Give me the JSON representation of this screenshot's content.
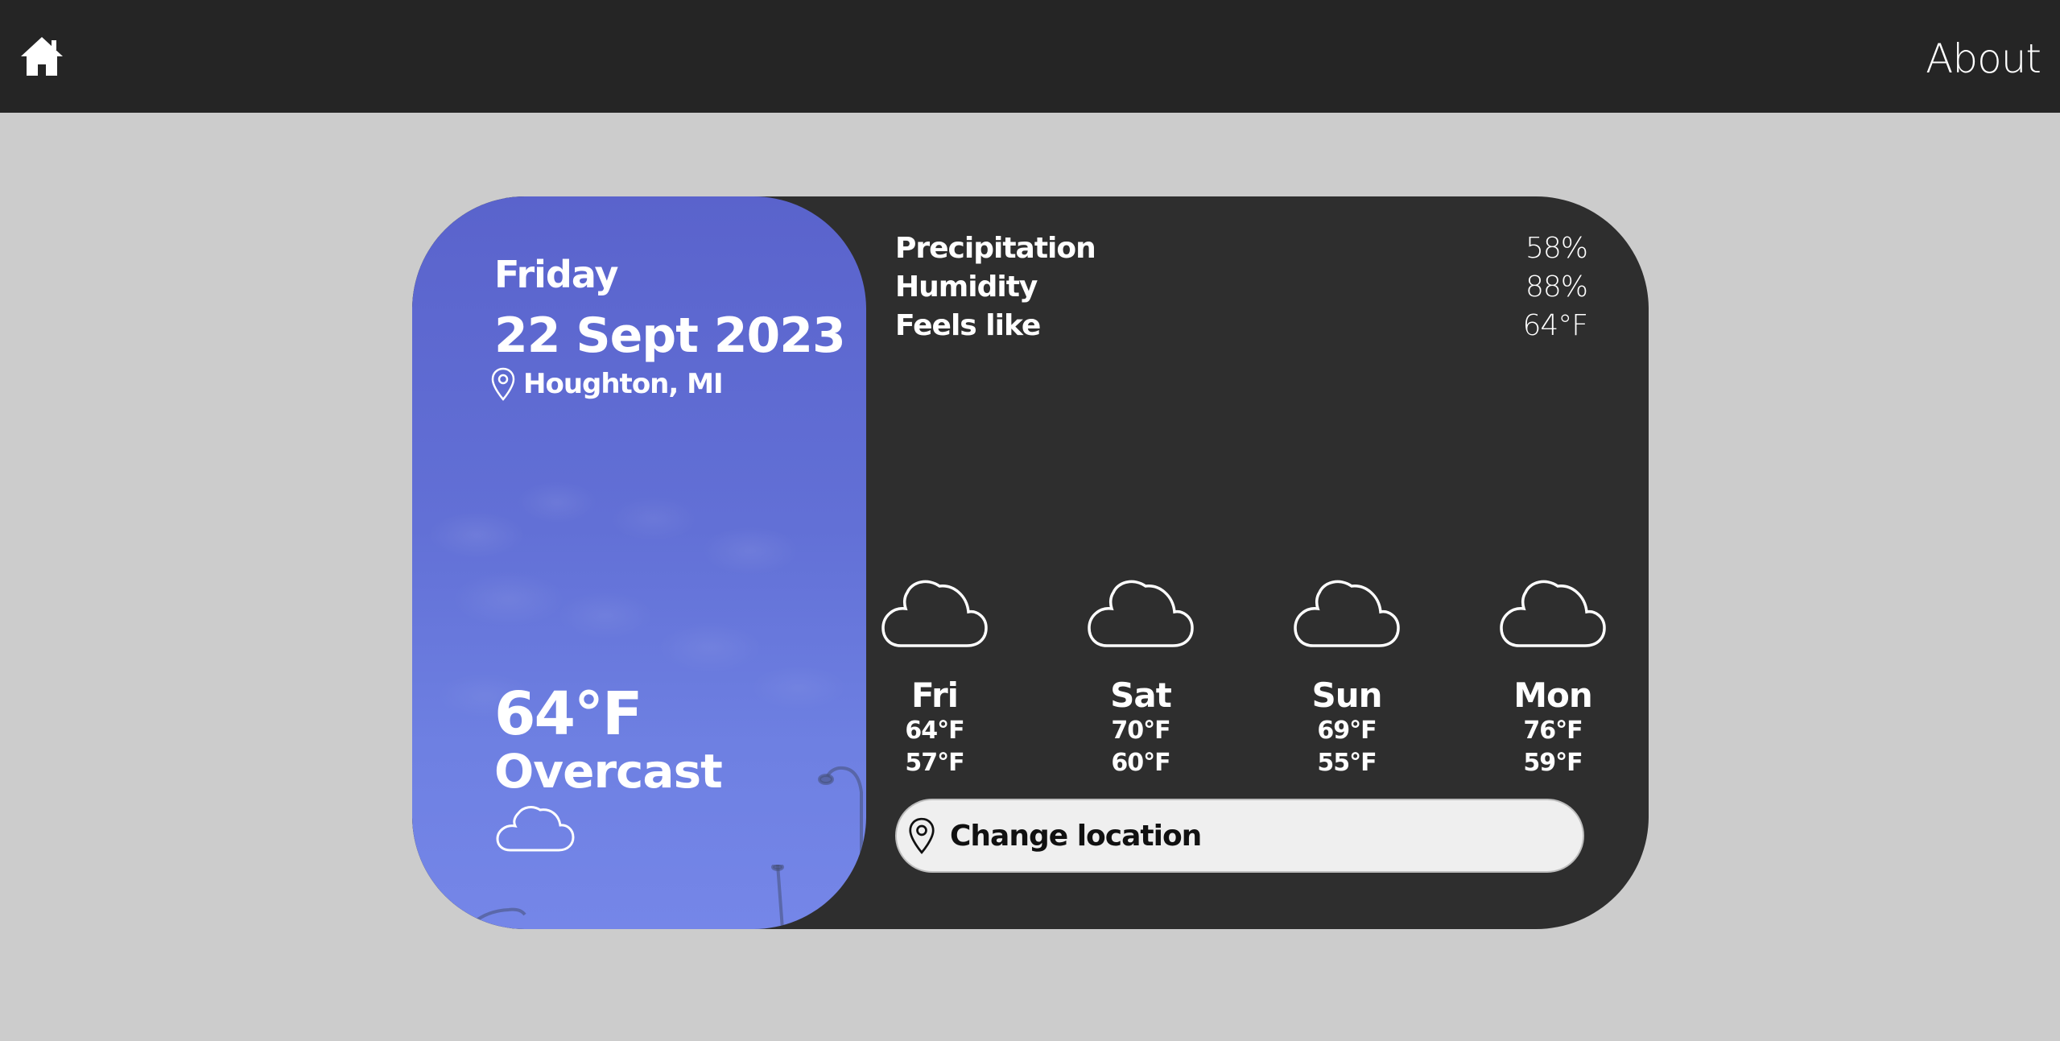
{
  "nav": {
    "home_icon": "home-icon",
    "about_label": "About"
  },
  "current": {
    "day": "Friday",
    "date": "22 Sept 2023",
    "location": "Houghton, MI",
    "temperature": "64°F",
    "condition": "Overcast",
    "condition_icon": "cloud-icon"
  },
  "stats": [
    {
      "label": "Precipitation",
      "value": "58%"
    },
    {
      "label": "Humidity",
      "value": "88%"
    },
    {
      "label": "Feels like",
      "value": "64°F"
    }
  ],
  "forecast": [
    {
      "day": "Fri",
      "high": "64°F",
      "low": "57°F",
      "icon": "cloud-icon"
    },
    {
      "day": "Sat",
      "high": "70°F",
      "low": "60°F",
      "icon": "cloud-icon"
    },
    {
      "day": "Sun",
      "high": "69°F",
      "low": "55°F",
      "icon": "cloud-icon"
    },
    {
      "day": "Mon",
      "high": "76°F",
      "low": "59°F",
      "icon": "cloud-icon"
    }
  ],
  "change_location": {
    "label": "Change location",
    "icon": "location-pin-icon"
  },
  "colors": {
    "topbar": "#252525",
    "page_background": "#cccccc",
    "card_background": "#2e2e2e",
    "left_panel_accent": "#6270d6",
    "button_background": "#efefef"
  }
}
